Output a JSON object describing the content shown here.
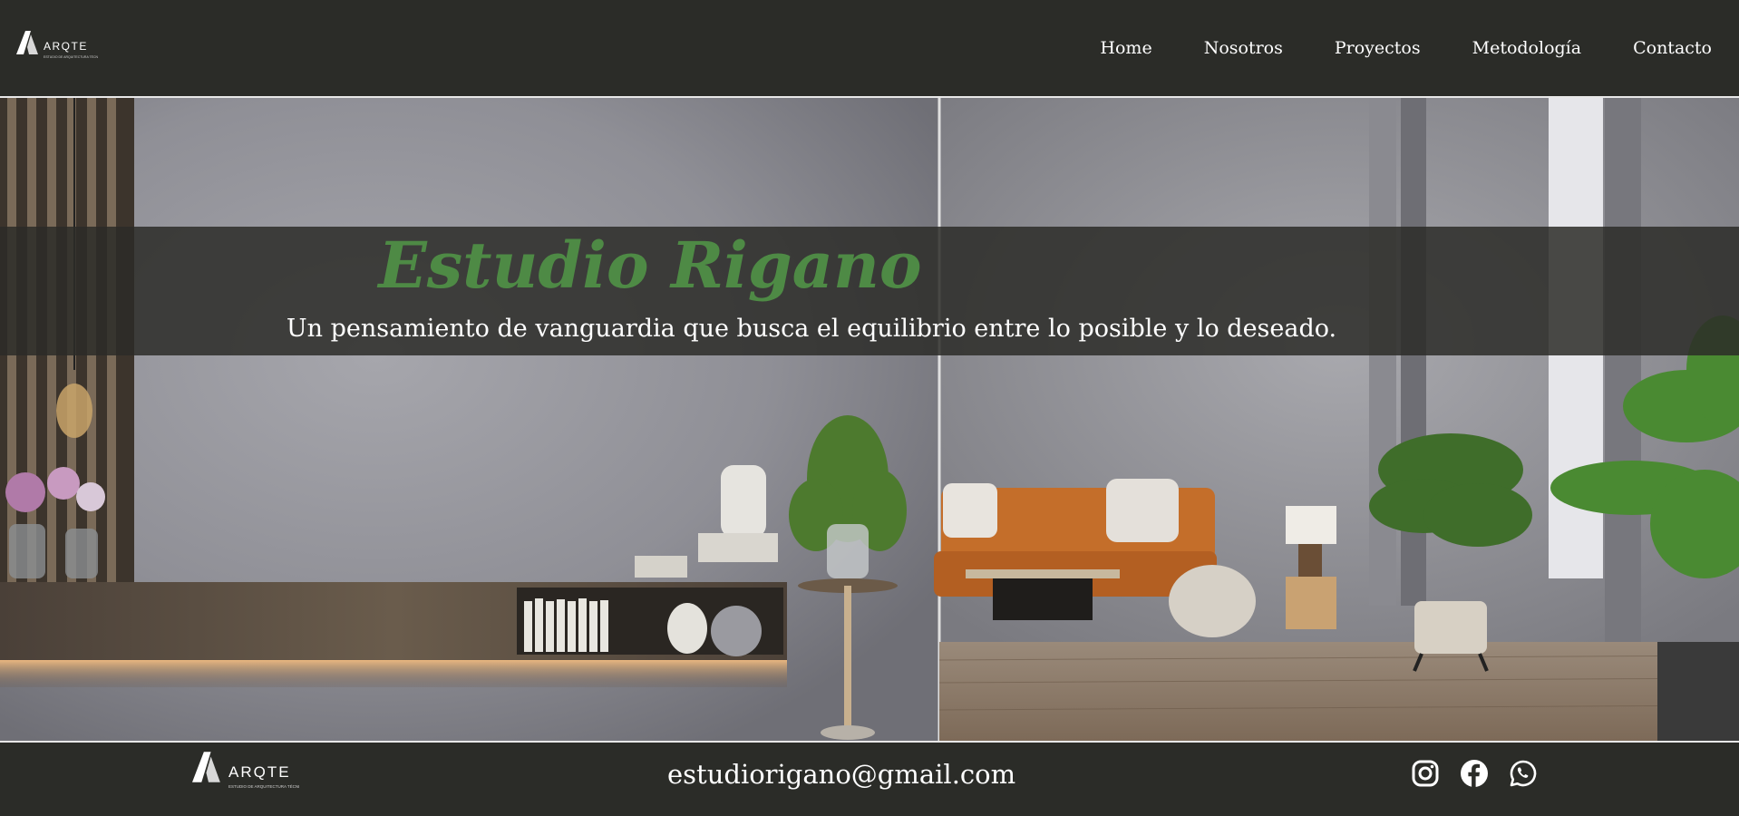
{
  "header": {
    "logo": {
      "word": "ARQTE",
      "tagline": "ESTUDIO DE ARQUITECTURA TÉCNICA",
      "icon": "arqte-logo-icon"
    },
    "nav": [
      {
        "label": "Home"
      },
      {
        "label": "Nosotros"
      },
      {
        "label": "Proyectos"
      },
      {
        "label": "Metodología"
      },
      {
        "label": "Contacto"
      }
    ]
  },
  "hero": {
    "title": "Estudio Rigano",
    "tagline": "Un pensamiento de vanguardia que busca el equilibrio entre lo posible y lo deseado.",
    "image": "living-room-interior-photo"
  },
  "footer": {
    "logo": {
      "word": "ARQTE",
      "tagline": "ESTUDIO DE ARQUITECTURA TÉCNICA",
      "icon": "arqte-logo-icon"
    },
    "email": "estudiorigano@gmail.com",
    "socials": [
      {
        "icon": "instagram-icon"
      },
      {
        "icon": "facebook-icon"
      },
      {
        "icon": "whatsapp-icon"
      }
    ]
  },
  "colors": {
    "bar_background": "#2b2c28",
    "title_green": "#4e8a45",
    "text": "#ffffff"
  }
}
